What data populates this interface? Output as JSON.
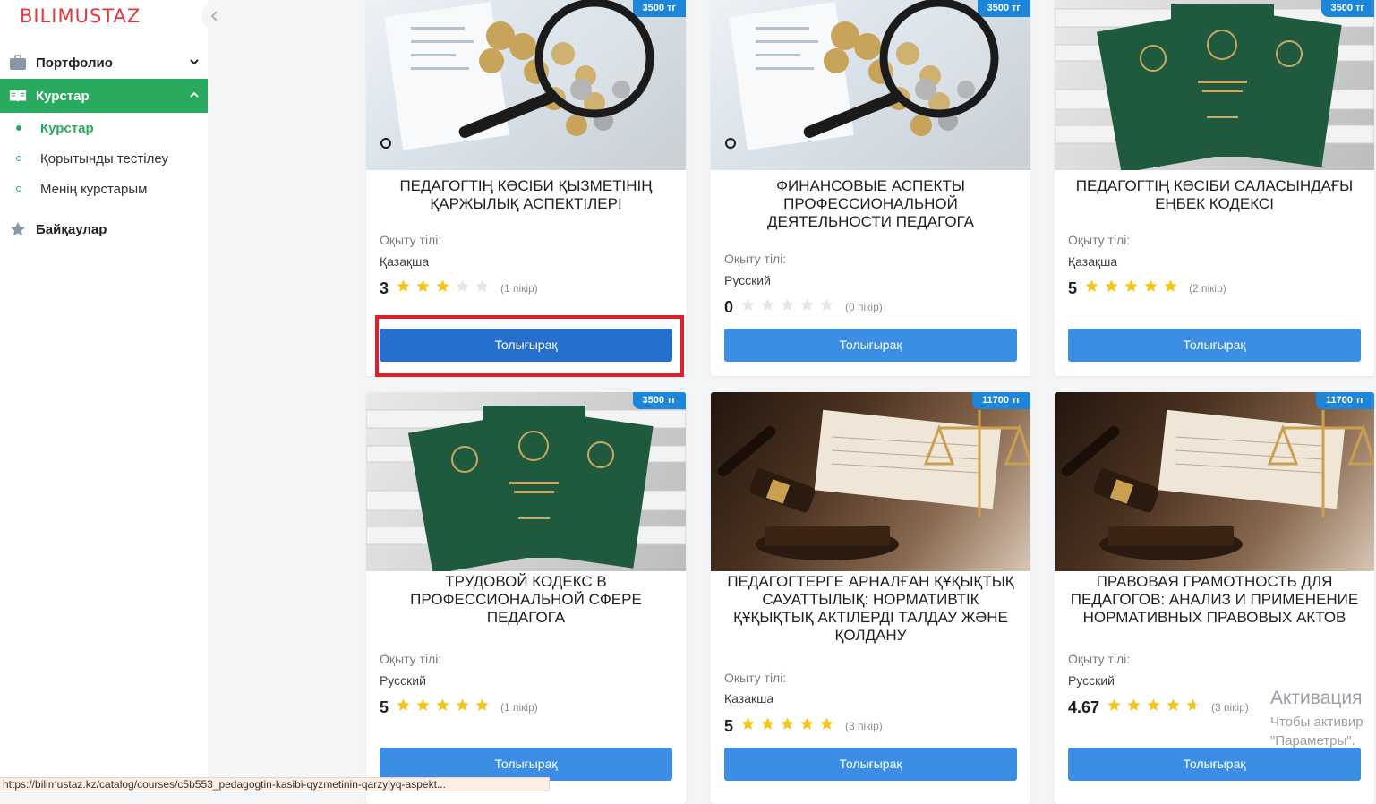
{
  "brand": {
    "logo": "BILIMUSTAZ"
  },
  "sidebar": {
    "collapse_icon": "chevron-left-icon",
    "items": [
      {
        "label": "Портфолио",
        "icon": "briefcase-icon",
        "chevron": "chevron-down-icon"
      },
      {
        "label": "Курстар",
        "icon": "book-icon",
        "chevron": "chevron-up-icon"
      },
      {
        "label": "Байқаулар",
        "icon": "star-icon"
      }
    ],
    "sub_items": [
      {
        "label": "Курстар"
      },
      {
        "label": "Қорытынды тестілеу"
      },
      {
        "label": "Менің курстарым"
      }
    ]
  },
  "common": {
    "language_label": "Оқыту тілі:",
    "button_label": "Толығырақ"
  },
  "cards": [
    {
      "price": "3500 тг",
      "title": "Педагогтің кәсіби қызметінің қаржылық аспектілері",
      "language": "Қазақша",
      "rating": "3",
      "rating_value": 3,
      "reviews": "(1 пікір)",
      "image": "magnifier-coins"
    },
    {
      "price": "3500 тг",
      "title": "Финансовые аспекты профессиональной деятельности педагога",
      "language": "Русский",
      "rating": "0",
      "rating_value": 0,
      "reviews": "(0 пікір)",
      "image": "magnifier-coins"
    },
    {
      "price": "3500 тг",
      "title": "Педагогтің кәсіби саласындағы еңбек кодексі",
      "language": "Қазақша",
      "rating": "5",
      "rating_value": 5,
      "reviews": "(2 пікір)",
      "image": "labor-books"
    },
    {
      "price": "3500 тг",
      "title": "Трудовой кодекс в профессиональной сфере педагога",
      "language": "Русский",
      "rating": "5",
      "rating_value": 5,
      "reviews": "(1 пікір)",
      "image": "labor-books"
    },
    {
      "price": "11700 тг",
      "title": "Педагогтерге арналған құқықтық сауаттылық: нормативтік құқықтық актілерді талдау және қолдану",
      "language": "Қазақша",
      "rating": "5",
      "rating_value": 5,
      "reviews": "(3 пікір)",
      "image": "gavel-scales"
    },
    {
      "price": "11700 тг",
      "title": "Правовая грамотность для педагогов: анализ и применение нормативных правовых актов",
      "language": "Русский",
      "rating": "4.67",
      "rating_value": 4.67,
      "reviews": "(3 пікір)",
      "image": "gavel-scales"
    }
  ],
  "colors": {
    "accent_green": "#2aaa5f",
    "button_blue": "#3b8ee3",
    "badge_blue": "#1e86d8",
    "star_gold": "#f5c518",
    "star_empty": "#e3e6ea",
    "highlight_red": "#e01f26",
    "logo_red": "#e8383d"
  },
  "statusbar": {
    "url": "https://bilimustaz.kz/catalog/courses/c5b553_pedagogtin-kasibi-qyzmetinin-qarzylyq-aspekt..."
  },
  "watermark": {
    "line1": "Активация",
    "line2": "Чтобы активир",
    "line3": "\"Параметры\"."
  }
}
